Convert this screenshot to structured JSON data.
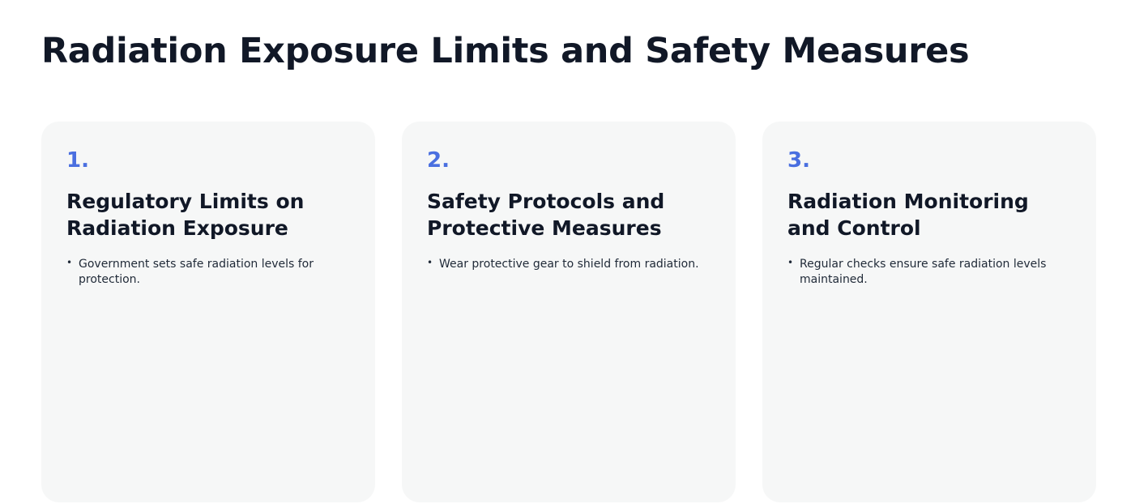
{
  "page": {
    "title": "Radiation Exposure Limits and Safety Measures"
  },
  "cards": [
    {
      "number": "1.",
      "title": "Regulatory Limits on Radiation Exposure",
      "bullets": [
        "Government sets safe radiation levels for protection."
      ]
    },
    {
      "number": "2.",
      "title": "Safety Protocols and Protective Measures",
      "bullets": [
        "Wear protective gear to shield from radiation."
      ]
    },
    {
      "number": "3.",
      "title": "Radiation Monitoring and Control",
      "bullets": [
        "Regular checks ensure safe radiation levels maintained."
      ]
    }
  ],
  "colors": {
    "accent": "#4a6fe0",
    "card_background": "#f6f7f7",
    "text": "#111827"
  }
}
